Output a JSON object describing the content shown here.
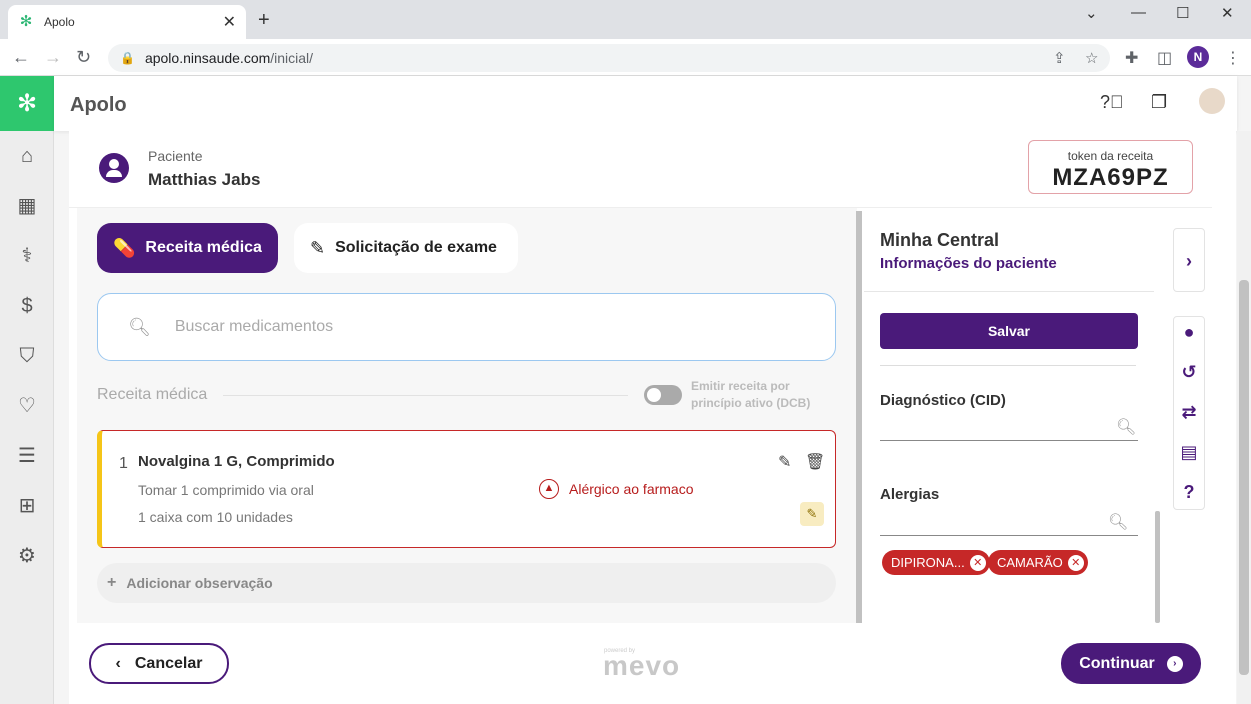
{
  "browser": {
    "tab_title": "Apolo",
    "url_host": "apolo.ninsaude.com",
    "url_path": "/inicial/",
    "profile_initial": "N"
  },
  "app": {
    "title": "Apolo"
  },
  "patient": {
    "label": "Paciente",
    "name": "Matthias Jabs"
  },
  "token": {
    "label": "token da receita",
    "value": "MZA69PZ"
  },
  "tabs": {
    "prescription": "Receita médica",
    "exam": "Solicitação de exame"
  },
  "search": {
    "placeholder": "Buscar medicamentos"
  },
  "prescription": {
    "section_title": "Receita médica",
    "toggle_label": "Emitir receita por princípio ativo (DCB)",
    "items": [
      {
        "number": "1",
        "name": "Novalgina 1 G, Comprimido",
        "dosage": "Tomar 1 comprimido via oral",
        "quantity": "1 caixa com 10 unidades",
        "warning": "Alérgico ao farmaco"
      }
    ],
    "add_observation": "Adicionar observação"
  },
  "side_panel": {
    "title": "Minha Central",
    "subtitle": "Informações do paciente",
    "save_label": "Salvar",
    "diagnosis_label": "Diagnóstico (CID)",
    "allergies_label": "Alergias",
    "allergy_chips": [
      "DIPIRONA...",
      "CAMARÃO"
    ]
  },
  "footer": {
    "cancel_label": "Cancelar",
    "brand": "mevo",
    "brand_small": "powered by",
    "continue_label": "Continuar"
  },
  "colors": {
    "primary": "#4a1a7a",
    "brand_green": "#2ec76e",
    "danger": "#c62828",
    "accent_yellow": "#f5c518"
  }
}
